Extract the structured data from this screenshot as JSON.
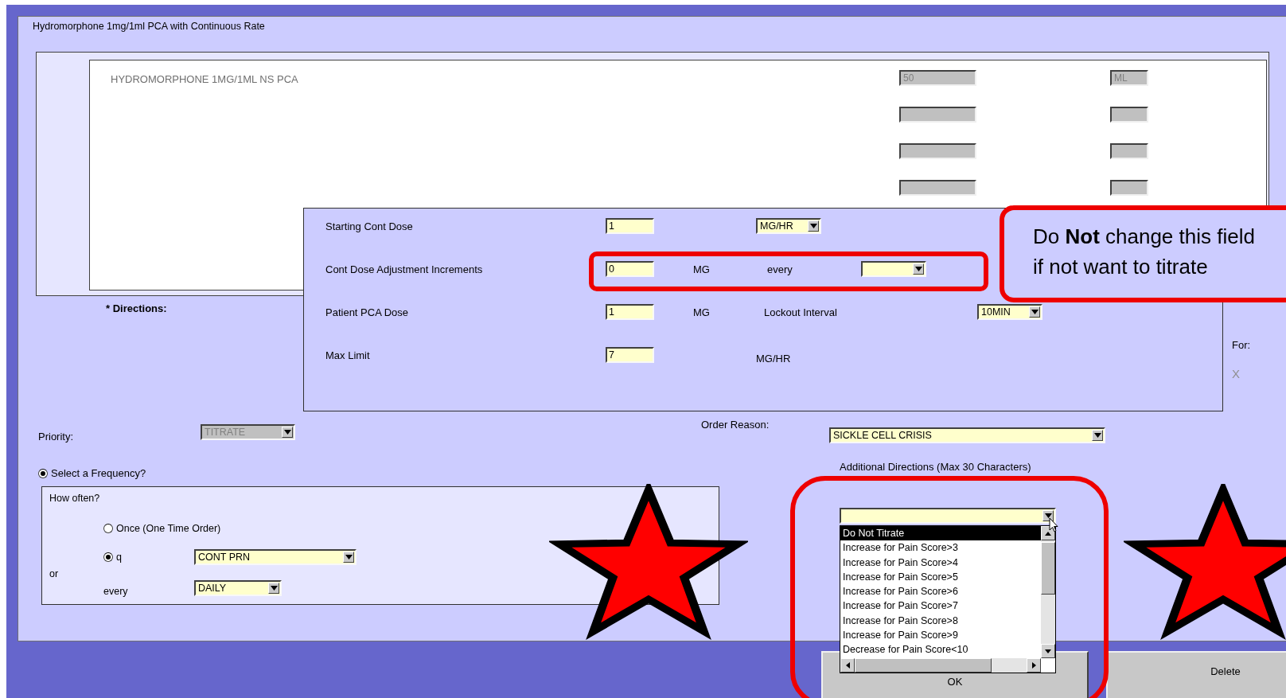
{
  "window": {
    "title": "Hydromorphone 1mg/1ml PCA with Continuous Rate"
  },
  "medication": {
    "name": "HYDROMORPHONE 1MG/1ML NS PCA",
    "dose_rows": [
      {
        "amount": "50",
        "unit": "ML",
        "disabled": true
      },
      {
        "disabled": true
      },
      {
        "disabled": true
      },
      {
        "disabled": true
      }
    ]
  },
  "directions_label": "* Directions:",
  "partly_hidden": {
    "for_label": "For:",
    "mark": "X"
  },
  "dose_panel": {
    "rows": [
      {
        "label": "Starting Cont Dose",
        "value": "1",
        "unit": "MG/HR",
        "kind": "dropdown"
      },
      {
        "label": "Cont Dose Adjustment Increments",
        "value": "0",
        "unit": "MG",
        "kind": "text",
        "extra_label": "every"
      },
      {
        "label": "Patient PCA Dose",
        "value": "1",
        "unit": "MG",
        "kind": "text",
        "extra_label": "Lockout Interval",
        "extra_value": "10MIN"
      },
      {
        "label": "Max Limit",
        "value": "7",
        "unit": "MG/HR",
        "kind": "text"
      }
    ]
  },
  "callout": "Do **Not** change this field\nif not want to titrate",
  "priority": {
    "label": "Priority:",
    "value": "TITRATE",
    "disabled": true
  },
  "order_reason": {
    "label": "Order Reason:",
    "value": "SICKLE CELL CRISIS"
  },
  "frequency": {
    "label": "Select a Frequency?",
    "selected": true
  },
  "how_often": {
    "title": "How often?",
    "options": [
      {
        "label": "Once (One Time Order)",
        "selected": false
      },
      {
        "label": "q",
        "selected": true
      }
    ],
    "or_label": "or",
    "every_label": "every",
    "frequency_value": "CONT PRN",
    "every_value": "DAILY"
  },
  "additional_directions": {
    "label": "Additional Directions (Max 30 Characters)",
    "expanded": true,
    "options": [
      {
        "label": "Do Not Titrate",
        "selected": true
      },
      {
        "label": "Increase for Pain Score>3",
        "selected": false
      },
      {
        "label": "Increase for Pain Score>4",
        "selected": false
      },
      {
        "label": "Increase for Pain Score>5",
        "selected": false
      },
      {
        "label": "Increase for Pain Score>6",
        "selected": false
      },
      {
        "label": "Increase for Pain Score>7",
        "selected": false
      },
      {
        "label": "Increase for Pain Score>8",
        "selected": false
      },
      {
        "label": "Increase for Pain Score>9",
        "selected": false
      },
      {
        "label": "Decrease for Pain Score<10",
        "selected": false
      }
    ]
  },
  "buttons": [
    {
      "label": "OK"
    },
    {
      "label": "Delete"
    }
  ]
}
